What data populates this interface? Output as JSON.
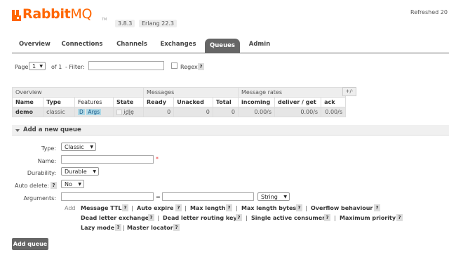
{
  "header": {
    "brand_rabbit": "Rabbit",
    "brand_mq": "MQ",
    "brand_tm": "TM",
    "version_rabbit": "3.8.3",
    "version_erlang": "Erlang 22.3",
    "refreshed": "Refreshed 20",
    "logo_color": "#ff6600"
  },
  "nav": {
    "tabs": [
      "Overview",
      "Connections",
      "Channels",
      "Exchanges",
      "Queues",
      "Admin"
    ],
    "active": "Queues"
  },
  "paging": {
    "page_label": "Page",
    "page_value": "1",
    "of_label": "of 1",
    "filter_label": "- Filter:",
    "filter_value": "",
    "regex_label": "Regex",
    "help": "?"
  },
  "table": {
    "groups": [
      "Overview",
      "Messages",
      "Message rates"
    ],
    "plus_minus": "+/-",
    "headers": [
      "Name",
      "Type",
      "Features",
      "State",
      "Ready",
      "Unacked",
      "Total",
      "incoming",
      "deliver / get",
      "ack"
    ],
    "rows": [
      {
        "name": "demo",
        "type": "classic",
        "feature_d": "D",
        "feature_args": "Args",
        "state": "idle",
        "ready": "0",
        "unacked": "0",
        "total": "0",
        "incoming": "0.00/s",
        "deliver_get": "0.00/s",
        "ack": "0.00/s"
      }
    ]
  },
  "add_queue": {
    "title": "Add a new queue",
    "type_label": "Type:",
    "type_value": "Classic",
    "name_label": "Name:",
    "name_value": "",
    "required_mark": "*",
    "durability_label": "Durability:",
    "durability_value": "Durable",
    "auto_delete_label": "Auto delete:",
    "auto_delete_help": "?",
    "auto_delete_value": "No",
    "arguments_label": "Arguments:",
    "eq": "=",
    "arg_type": "String",
    "add_label": "Add",
    "args_row1": [
      "Message TTL",
      "Auto expire",
      "Max length",
      "Max length bytes",
      "Overflow behaviour"
    ],
    "args_row2": [
      "Dead letter exchange",
      "Dead letter routing key",
      "Single active consumer",
      "Maximum priority"
    ],
    "args_row3": [
      "Lazy mode",
      "Master locator"
    ],
    "help": "?",
    "sep": "|",
    "submit": "Add queue"
  }
}
